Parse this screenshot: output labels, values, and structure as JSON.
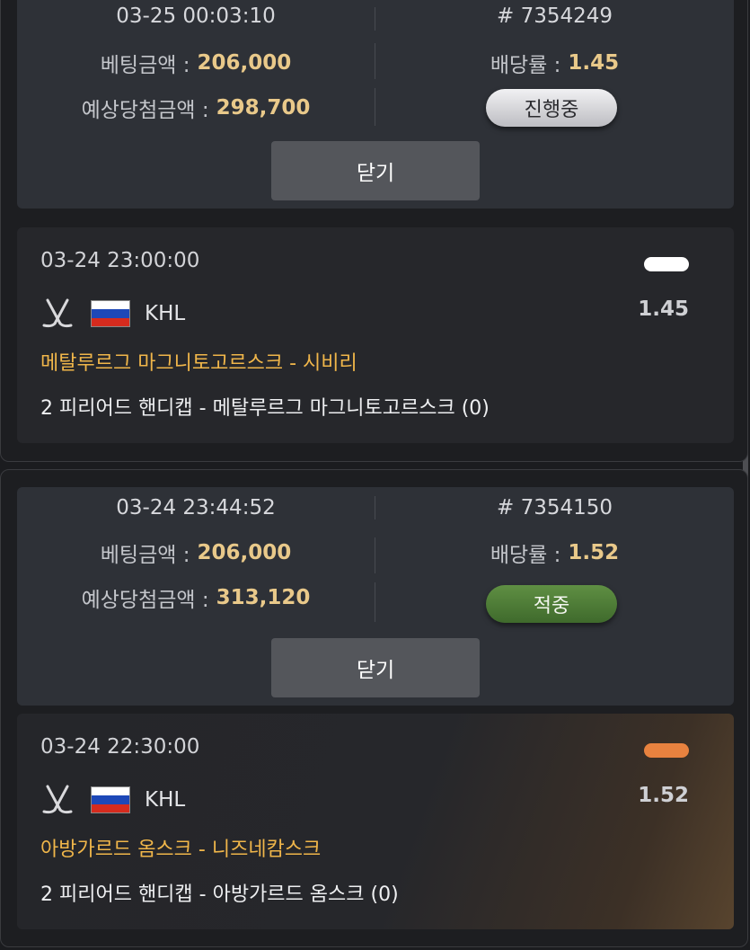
{
  "bets": [
    {
      "datetime": "03-25 00:03:10",
      "ticket": "# 7354249",
      "stake_label": "베팅금액 :",
      "stake": "206,000",
      "odds_label": "배당률 :",
      "odds": "1.45",
      "payout_label": "예상당첨금액 :",
      "payout": "298,700",
      "status": "진행중",
      "close": "닫기",
      "game": {
        "datetime": "03-24 23:00:00",
        "result_color": "#ffffff",
        "sport_icon": "hockey-sticks-icon",
        "country_flag": "russia-flag-icon",
        "league": "KHL",
        "odds": "1.45",
        "teams": "메탈루르그 마그니토고르스크 - 시비리",
        "pick": "2 피리어드 핸디캡 - 메탈루르그 마그니토고르스크 (0)"
      }
    },
    {
      "datetime": "03-24 23:44:52",
      "ticket": "# 7354150",
      "stake_label": "베팅금액 :",
      "stake": "206,000",
      "odds_label": "배당률 :",
      "odds": "1.52",
      "payout_label": "예상당첨금액 :",
      "payout": "313,120",
      "status": "적중",
      "close": "닫기",
      "game": {
        "datetime": "03-24 22:30:00",
        "result_color": "#e8823f",
        "sport_icon": "hockey-sticks-icon",
        "country_flag": "russia-flag-icon",
        "league": "KHL",
        "odds": "1.52",
        "teams": "아방가르드 옴스크 - 니즈네캄스크",
        "pick": "2 피리어드 핸디캡 - 아방가르드 옴스크 (0)"
      }
    }
  ],
  "colors": {
    "amount": "#e9c98a",
    "teams": "#f0b64a",
    "status_win": "#4f7d38",
    "status_progress": "#d9d9dc"
  }
}
